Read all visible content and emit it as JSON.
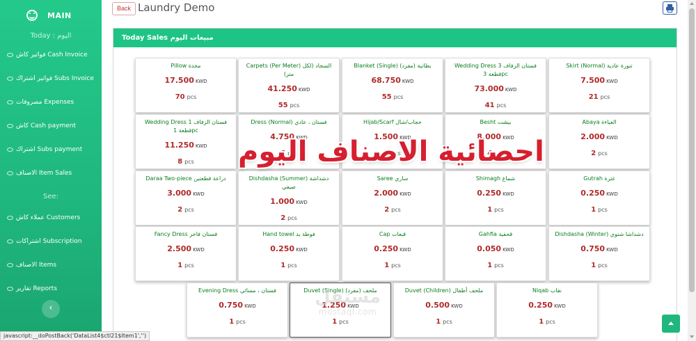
{
  "sidebar": {
    "brand": "MAIN",
    "today_title": "Today : اليوم",
    "today_items": [
      {
        "label": "فواتير كاش Cash Invoice"
      },
      {
        "label": "فواتير اشتراك Subs Invoice"
      },
      {
        "label": "مصروفات Expenses"
      },
      {
        "label": "كاش Cash payment"
      },
      {
        "label": "اشتراك Subs payment"
      },
      {
        "label": "الاصناف Item Sales"
      }
    ],
    "see_title": "See:",
    "see_items": [
      {
        "label": "عملاء كاش Customers"
      },
      {
        "label": "اشتراكات Subscription"
      },
      {
        "label": "الاصناف Items"
      },
      {
        "label": "تقارير Reports"
      }
    ],
    "collapse_icon": "‹"
  },
  "header": {
    "back_label": "Back",
    "title": "Laundry Demo"
  },
  "panel": {
    "title": "Today Sales مبيعات اليوم"
  },
  "currency": "KWD",
  "unit": "pcs",
  "items": [
    {
      "name": "Pillow مخدة",
      "price": "17.500",
      "qty": "70"
    },
    {
      "name": "Carpets (Per Meter) السجاد (لكل متر)",
      "price": "41.250",
      "qty": "55"
    },
    {
      "name": "Blanket (Single) بطانية (مفرد)",
      "price": "68.750",
      "qty": "55"
    },
    {
      "name": "Wedding Dress فستان الزفاف 3 قطعة 3pc",
      "price": "73.000",
      "qty": "41"
    },
    {
      "name": "Skirt (Normal) تنورة عادية",
      "price": "7.500",
      "qty": "21"
    },
    {
      "name": "Wedding Dress فستان الزفاف 1 قطعة 1pc",
      "price": "11.250",
      "qty": "8"
    },
    {
      "name": "Dress (Normal) فستان ، عادي",
      "price": "4.750",
      "qty": "6"
    },
    {
      "name": "Hijab/Scarf حجاب/شال",
      "price": "1.500",
      "qty": "4"
    },
    {
      "name": "Besht بيشت",
      "price": "8.000",
      "qty": "4"
    },
    {
      "name": "Abaya العباءة",
      "price": "2.000",
      "qty": "2"
    },
    {
      "name": "Daraa Two-piece دراعة قطعتين",
      "price": "3.000",
      "qty": "2"
    },
    {
      "name": "Dishdasha (Summer) دشداشة صيفي",
      "price": "1.000",
      "qty": "2"
    },
    {
      "name": "Saree ساري",
      "price": "2.000",
      "qty": "2"
    },
    {
      "name": "Shimagh شماغ",
      "price": "0.250",
      "qty": "1"
    },
    {
      "name": "Gutrah غترة",
      "price": "0.250",
      "qty": "1"
    },
    {
      "name": "Fancy Dress فستان فاخر",
      "price": "2.500",
      "qty": "1"
    },
    {
      "name": "Hand towel فوطة يد",
      "price": "0.250",
      "qty": "1"
    },
    {
      "name": "Cap قبعات",
      "price": "0.250",
      "qty": "1"
    },
    {
      "name": "Gahfia قحفية",
      "price": "0.050",
      "qty": "1"
    },
    {
      "name": "Dishdasha (Winter) دشداشا شتوي",
      "price": "0.750",
      "qty": "1"
    },
    {
      "name": "Evening Dress فستان ، مسائي",
      "price": "0.750",
      "qty": "1"
    },
    {
      "name": "Duvet (Single) ملحف (مفرد)",
      "price": "1.250",
      "qty": "1"
    },
    {
      "name": "Duvet (Children) ملحف أطفال",
      "price": "0.500",
      "qty": "1"
    },
    {
      "name": "Niqab نقاب",
      "price": "0.250",
      "qty": "1"
    }
  ],
  "overlay_text": "احصائية الاصناف اليوم",
  "watermark": {
    "ar": "مستقل",
    "en": "mostaql.com"
  },
  "status_bar": "javascript:__doPostBack('DataList4$ctl21$Item1','')",
  "icons": {
    "brand": "smile-icon",
    "print": "print-icon",
    "to_top": "chevron-up-icon",
    "nav": "eye-icon"
  },
  "colors": {
    "accent": "#1ec483",
    "price": "#b02a2a",
    "item_name": "#0a7d1f",
    "back": "#c0392b",
    "overlay": "#d61f2f"
  }
}
